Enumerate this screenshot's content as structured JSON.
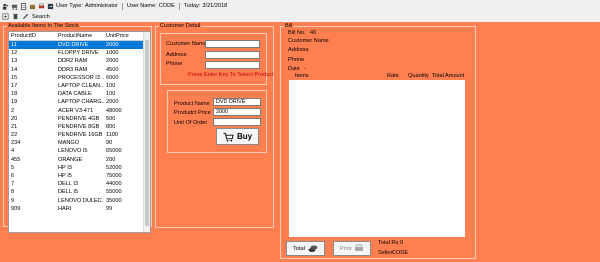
{
  "toolbar": {
    "user_type_label": "User Type:",
    "user_type_value": "Administrator",
    "user_name_label": "User Name:",
    "user_name_value": "CODE",
    "today_label": "Today:",
    "today_value": "3/21/2018",
    "search_label": "Search"
  },
  "stock": {
    "title": "Available Items In The Stock",
    "columns": [
      "ProductID",
      "ProductName",
      "UnitPrice"
    ],
    "rows": [
      [
        "11",
        "DVD DRIVE",
        "2000"
      ],
      [
        "12",
        "FLOPPY DRIVE",
        "1000"
      ],
      [
        "13",
        "DDR2 RAM",
        "2000"
      ],
      [
        "14",
        "DDR3 RAM",
        "4500"
      ],
      [
        "15",
        "PROCESSOR I3 ...",
        "6000"
      ],
      [
        "17",
        "LAPTOP CLEAN...",
        "100"
      ],
      [
        "18",
        "DATA CABLE",
        "100"
      ],
      [
        "19",
        "LAPTOP CHARG...",
        "2000"
      ],
      [
        "2",
        "ACER V3-471",
        "48000"
      ],
      [
        "20",
        "PENDRIVE 4GB",
        "500"
      ],
      [
        "21",
        "PENDRIVE 8GB",
        "800"
      ],
      [
        "22",
        "PENDRIVE 16GB",
        "1100"
      ],
      [
        "234",
        "MANGO",
        "90"
      ],
      [
        "4",
        "LENOVO I5",
        "65000"
      ],
      [
        "455",
        "ORANGE",
        "200"
      ],
      [
        "5",
        "HP I3",
        "52000"
      ],
      [
        "6",
        "HP I5",
        "75000"
      ],
      [
        "7",
        "DELL I3",
        "44000"
      ],
      [
        "8",
        "DELL I5",
        "55000"
      ],
      [
        "9",
        "LENOVO DULEC...",
        "35000"
      ],
      [
        "909",
        "HARI",
        "99"
      ]
    ],
    "selected_index": 0
  },
  "customer": {
    "title": "Customer Detail",
    "name_label": "Customer Name",
    "address_label": "Address",
    "phone_label": "Phone",
    "name_value": "",
    "address_value": "",
    "phone_value": "",
    "warning": "Press Enter Key To Select Product"
  },
  "product": {
    "name_label": "Product Name",
    "name_value": "DVD DRIVE",
    "price_label": "Produdct Price",
    "price_value": "2000",
    "unit_label": "Unit Of Order",
    "unit_value": "",
    "buy_label": "Buy"
  },
  "bill": {
    "title": "Bill",
    "bill_no_label": "Bill No.",
    "bill_no_value": "40",
    "customer_name_label": "Customer Name",
    "address_label": "Address",
    "phone_label": "Phone",
    "date_label": "Date",
    "date_value": "-",
    "columns": [
      "Items",
      "Rate",
      "Quantity",
      "Total Amount"
    ],
    "total_button": "Total",
    "print_button": "Print",
    "total_rs_label": "Total Rs.",
    "total_rs_value": "0",
    "seller_label": "Seller:",
    "seller_value": "CODE"
  },
  "colors": {
    "background": "#ff7f50",
    "selection": "#0078d7",
    "warning": "#c00000"
  },
  "icons": [
    "user-group-icon",
    "cart-icon",
    "document-icon",
    "box-icon",
    "print-icon",
    "logout-icon",
    "add-icon",
    "delete-icon",
    "edit-icon",
    "stack-coins-icon",
    "printer-icon"
  ]
}
